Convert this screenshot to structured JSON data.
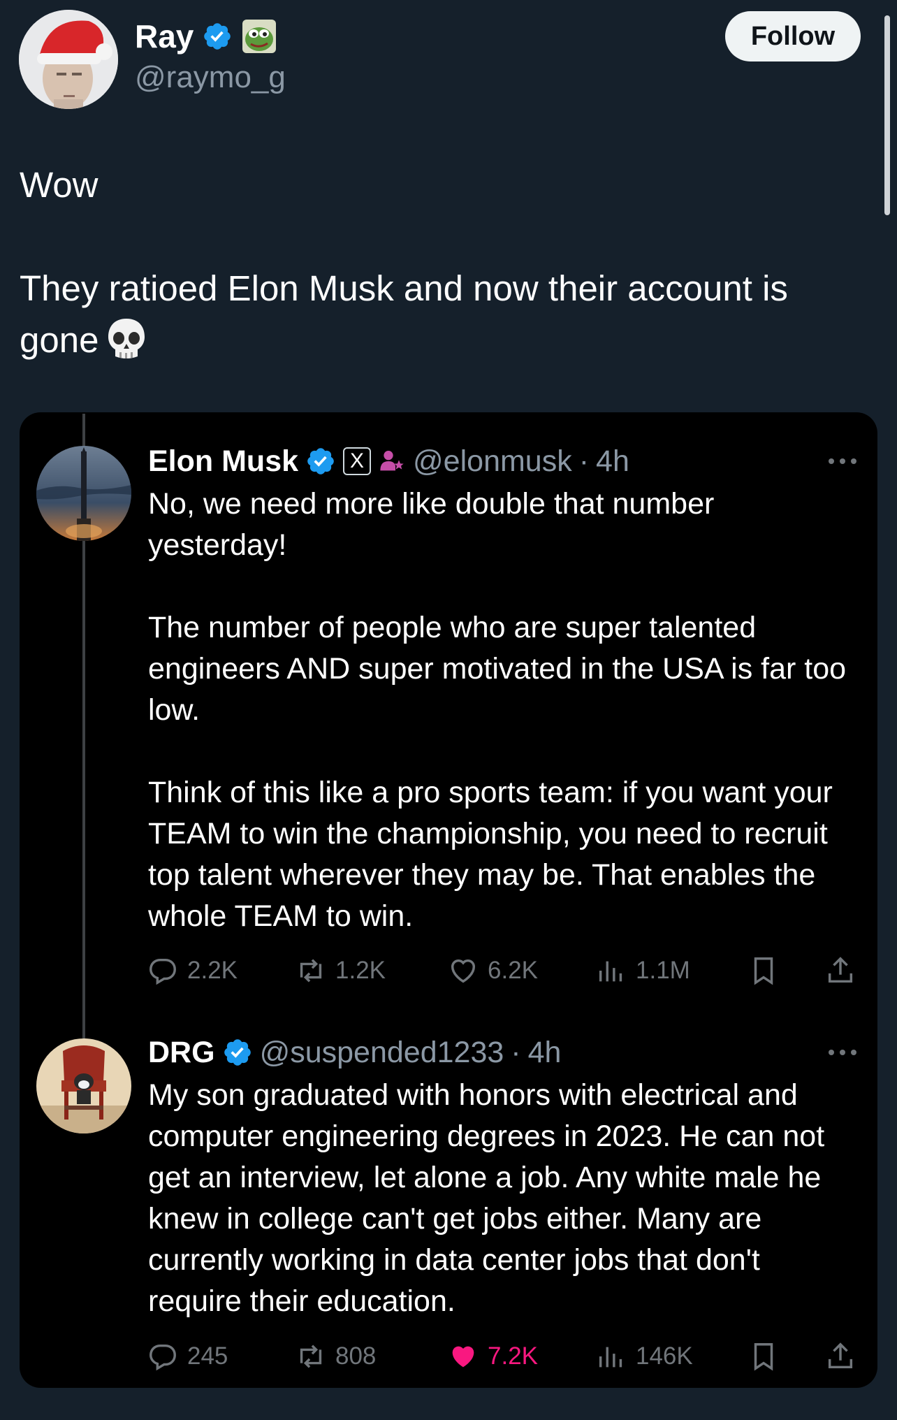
{
  "header": {
    "display_name": "Ray",
    "handle": "@raymo_g",
    "follow_label": "Follow"
  },
  "tweet": {
    "line1": "Wow",
    "line2": "They ratioed Elon Musk and now their account is gone"
  },
  "quoted": [
    {
      "name": "Elon Musk",
      "affiliate_badge": "X",
      "handle": "@elonmusk",
      "separator": "·",
      "time": "4h",
      "paragraphs": [
        "No, we need more like double that number yesterday!",
        "The number of people who are super talented engineers AND super motivated in the USA is far too low.",
        "Think of this like a pro sports team: if you want your TEAM to win the championship, you need to recruit top talent wherever they may be. That enables the whole TEAM to win."
      ],
      "stats": {
        "replies": "2.2K",
        "reposts": "1.2K",
        "likes": "6.2K",
        "views": "1.1M"
      },
      "liked": false
    },
    {
      "name": "DRG",
      "handle": "@suspended1233",
      "separator": "·",
      "time": "4h",
      "paragraphs": [
        "My son graduated with honors with electrical and computer engineering degrees in 2023. He can not get an interview, let alone a job.  Any white male he knew in college can't get jobs either. Many are currently working in data center jobs that don't require their education."
      ],
      "stats": {
        "replies": "245",
        "reposts": "808",
        "likes": "7.2K",
        "views": "146K"
      },
      "liked": true
    }
  ],
  "colors": {
    "background": "#15202b",
    "card": "#000000",
    "verified_blue": "#1d9bf0",
    "like_pink": "#f91880",
    "muted": "#71767b"
  }
}
